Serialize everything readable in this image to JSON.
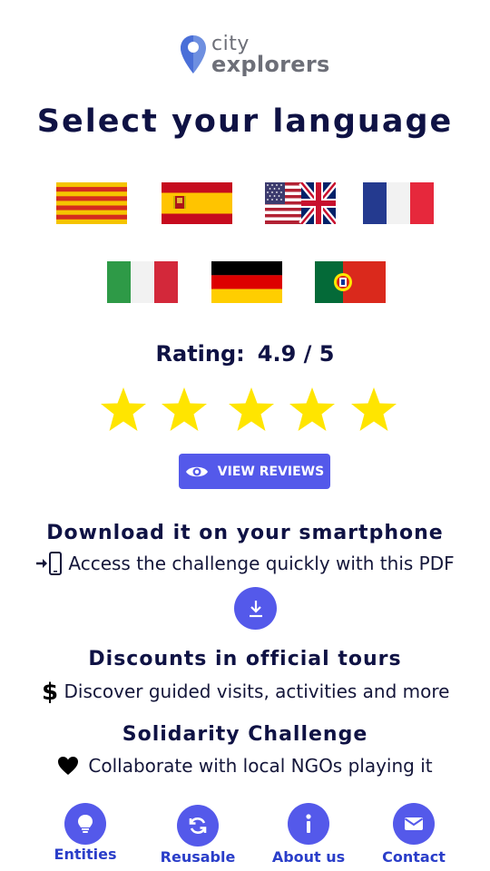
{
  "brand": {
    "line1": "city",
    "line2": "explorers"
  },
  "title": "Select your language",
  "languages": [
    {
      "code": "ca",
      "name": "Catalan"
    },
    {
      "code": "es",
      "name": "Spanish"
    },
    {
      "code": "en",
      "name": "English"
    },
    {
      "code": "fr",
      "name": "French"
    },
    {
      "code": "it",
      "name": "Italian"
    },
    {
      "code": "de",
      "name": "German"
    },
    {
      "code": "pt",
      "name": "Portuguese"
    }
  ],
  "rating": {
    "label": "Rating:",
    "value": "4.9 / 5",
    "stars_filled": 5,
    "stars_total": 5
  },
  "reviews_button": "VIEW REVIEWS",
  "download": {
    "title": "Download it on your smartphone",
    "text": "Access the challenge quickly with this PDF"
  },
  "discounts": {
    "title": "Discounts in official tours",
    "text": "Discover guided visits, activities and more"
  },
  "solidarity": {
    "title": "Solidarity Challenge",
    "text": "Collaborate with local NGOs playing it"
  },
  "bottom_nav": [
    {
      "label": "Entities",
      "icon": "lightbulb-icon"
    },
    {
      "label": "Reusable",
      "icon": "refresh-icon"
    },
    {
      "label": "About us",
      "icon": "info-icon"
    },
    {
      "label": "Contact",
      "icon": "envelope-icon"
    }
  ],
  "colors": {
    "accent": "#5459ea",
    "heading": "#0f1244",
    "star": "#ffe500",
    "nav_label": "#2a3ec9"
  }
}
